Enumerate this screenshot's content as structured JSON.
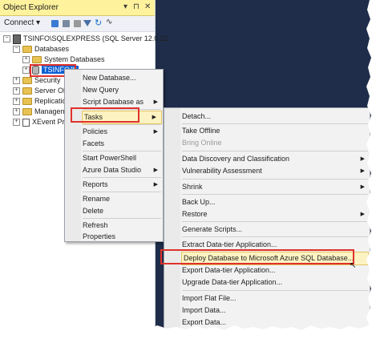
{
  "object_explorer": {
    "title": "Object Explorer",
    "pin": "▾",
    "pin2": "⊓",
    "close": "✕",
    "toolbar": {
      "connect": "Connect ▾",
      "icons": [
        "connect-icon",
        "disconnect-icon",
        "filter-icon",
        "stop-icon",
        "refresh-icon",
        "activity-icon"
      ]
    },
    "tree": {
      "server": "TSINFO\\SQLEXPRESS (SQL Server 12.0.22",
      "databases": "Databases",
      "system_databases": "System Databases",
      "selected_db": "TSINFO™",
      "security": "Security",
      "server_objects": "Server Ob",
      "replication": "Replicatio",
      "management": "Managem",
      "xevent": "XEvent Pro"
    }
  },
  "context_menu": [
    "New Database...",
    "New Query",
    "Script Database as",
    "Tasks",
    "Policies",
    "Facets",
    "Start PowerShell",
    "Azure Data Studio",
    "Reports",
    "Rename",
    "Delete",
    "Refresh",
    "Properties"
  ],
  "tasks_menu": [
    "Detach...",
    "Take Offline",
    "Bring Online",
    "Data Discovery and Classification",
    "Vulnerability Assessment",
    "Shrink",
    "Back Up...",
    "Restore",
    "Generate Scripts...",
    "Extract Data-tier Application...",
    "Deploy Database to Microsoft Azure SQL Database...",
    "Export Data-tier Application...",
    "Upgrade Data-tier Application...",
    "Import Flat File...",
    "Import Data...",
    "Export Data..."
  ],
  "arrow": "▶"
}
